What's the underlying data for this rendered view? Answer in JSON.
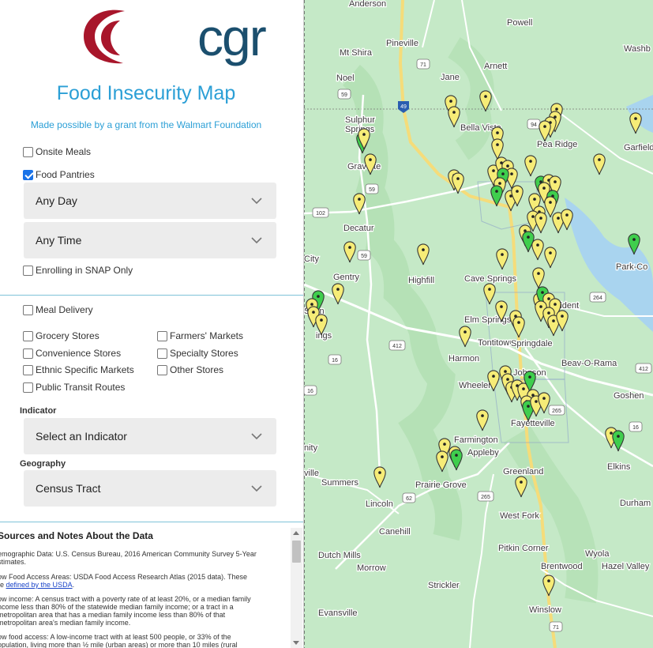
{
  "panel": {
    "logo_text": "cgr",
    "title": "Food Insecurity Map",
    "subtitle": "Made possible by a grant from the Walmart Foundation",
    "filters": {
      "onsite_meals": {
        "label": "Onsite Meals",
        "checked": false
      },
      "food_pantries": {
        "label": "Food Pantries",
        "checked": true
      },
      "any_day": "Any Day",
      "any_time": "Any Time",
      "enrolling_snap": {
        "label": "Enrolling in SNAP Only",
        "checked": false
      }
    },
    "layers": {
      "meal_delivery": "Meal Delivery",
      "grocery_stores": "Grocery Stores",
      "farmers_markets": "Farmers' Markets",
      "convenience_stores": "Convenience Stores",
      "specialty_stores": "Specialty Stores",
      "ethnic_markets": "Ethnic Specific Markets",
      "other_stores": "Other Stores",
      "transit_routes": "Public Transit Routes"
    },
    "indicator": {
      "label": "Indicator",
      "value": "Select an Indicator"
    },
    "geography": {
      "label": "Geography",
      "value": "Census Tract"
    },
    "notes": {
      "title": "Sources and Notes About the Data",
      "demographic_1": "emographic Data: U.S. Census Bureau, 2016 American Community Survey 5-Year",
      "demographic_2": "stimates.",
      "low_food_1": "ow Food Access Areas: USDA Food Access Research Atlas (2015 data). These",
      "low_food_2": "re ",
      "low_food_link": "defined by the USDA",
      "low_food_end": ".",
      "low_income_1": "ow income: A census tract with a poverty rate of at least 20%, or a median family",
      "low_income_2": "ncome less than 80% of the statewide median family income; or a tract in a",
      "low_income_3": "metropolitan area that has a median family income less than 80% of that",
      "low_income_4": "metropolitan area's median family income.",
      "low_access_1": "ow food access: A low-income tract with at least 500 people, or 33% of the",
      "low_access_2": "opulation, living more than ½ mile (urban areas) or more than 10 miles (rural"
    }
  },
  "map": {
    "places": {
      "anderson": "Anderson",
      "powell": "Powell",
      "washb": "Washb",
      "pineville": "Pineville",
      "mt_shira": "Mt Shira",
      "arnett": "Arnett",
      "noel": "Noel",
      "jane": "Jane",
      "sulphur_springs_1": "Sulphur",
      "sulphur_springs_2": "Springs",
      "bella_vista": "Bella Vista",
      "pea_ridge": "Pea Ridge",
      "garfield": "Garfield",
      "gravette": "Gravette",
      "decatur": "Decatur",
      "city": "City",
      "gentry": "Gentry",
      "highfill": "Highfill",
      "cave_springs": "Cave Springs",
      "pa_co": "Park-Co",
      "accident": "Accident",
      "elm_springs": "Elm Springs",
      "tontitown": "Tontitown",
      "springdale": "Springdale",
      "harmon": "Harmon",
      "beav_o_rama": "Beav-O-Rama",
      "johnson": "Johnson",
      "wheeler": "Wheeler",
      "goshen": "Goshen",
      "fayetteville": "Fayetteville",
      "farmington": "Farmington",
      "appleby": "Appleby",
      "nity": "nity",
      "greenland": "Greenland",
      "elkins": "Elkins",
      "summers": "Summers",
      "ville": "ville",
      "prairie_grove": "Prairie Grove",
      "lincoln": "Lincoln",
      "west_fork": "West Fork",
      "durham": "Durham",
      "canehill": "Canehill",
      "dutch_mills": "Dutch Mills",
      "pitkin_corner": "Pitkin Corner",
      "wyola": "Wyola",
      "morrow": "Morrow",
      "brentwood": "Brentwood",
      "hazel_valley": "Hazel Valley",
      "strickler": "Strickler",
      "winslow": "Winslow",
      "evansville": "Evansville",
      "sprin": "Sprin",
      "ings": "ings"
    },
    "shields": [
      "71",
      "59",
      "49",
      "94",
      "59",
      "102",
      "59",
      "412",
      "16",
      "16",
      "265",
      "16",
      "265",
      "62",
      "71",
      "264",
      "412"
    ],
    "colors": {
      "pantry": "#f6ec77",
      "meal": "#3fce4d",
      "water": "#a9d4ef",
      "road": "#ffffff",
      "highway": "#f5dc7a",
      "land": "#c5e9c7",
      "park": "#a6d9a6"
    }
  }
}
